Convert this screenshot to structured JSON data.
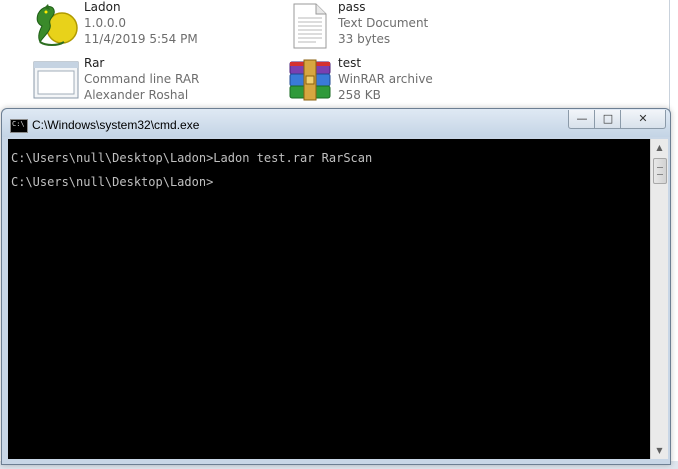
{
  "explorer": {
    "files": [
      {
        "name": "Ladon",
        "line1": "1.0.0.0",
        "line2": "11/4/2019 5:54 PM",
        "icon": "dragon-icon"
      },
      {
        "name": "pass",
        "line1": "Text Document",
        "line2": "33 bytes",
        "icon": "text-document-icon"
      },
      {
        "name": "Rar",
        "line1": "Command line RAR",
        "line2": "Alexander Roshal",
        "icon": "rar-exe-icon"
      },
      {
        "name": "test",
        "line1": "WinRAR archive",
        "line2": "258 KB",
        "icon": "winrar-archive-icon"
      }
    ]
  },
  "cmd": {
    "title": "C:\\Windows\\system32\\cmd.exe",
    "lines": [
      "C:\\Users\\null\\Desktop\\Ladon>Ladon test.rar RarScan",
      "C:\\Users\\null\\Desktop\\Ladon>"
    ],
    "buttons": {
      "minimize": "—",
      "maximize": "□",
      "close": "✕"
    }
  }
}
